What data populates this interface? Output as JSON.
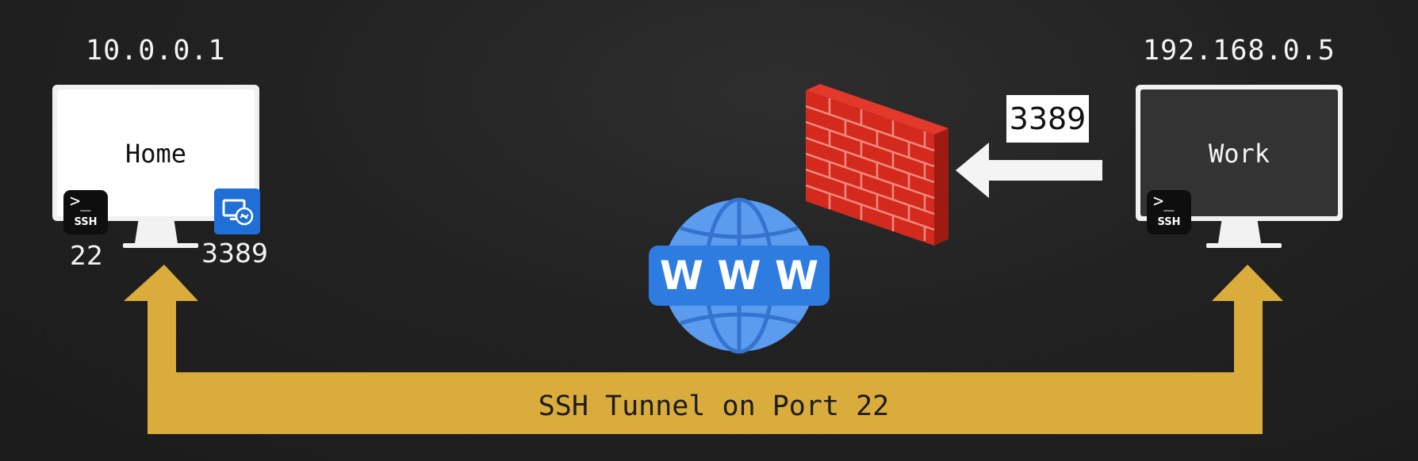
{
  "home": {
    "ip": "10.0.0.1",
    "label": "Home",
    "ssh_port": "22",
    "rdp_port": "3389",
    "ssh_badge_prompt": ">_",
    "ssh_badge_text": "SSH"
  },
  "work": {
    "ip": "192.168.0.5",
    "label": "Work",
    "ssh_badge_prompt": ">_",
    "ssh_badge_text": "SSH"
  },
  "blocked_port": "3389",
  "globe_text": "W W W",
  "tunnel": {
    "label": "SSH Tunnel on Port 22",
    "color": "#d9ac3c"
  },
  "colors": {
    "background": "#222222",
    "home_screen": "#ffffff",
    "work_screen": "#333333",
    "firewall": "#d42a1e",
    "globe": "#4a8be3",
    "rdp_badge": "#1f6fd6"
  },
  "icons": [
    "ssh-terminal-icon",
    "remote-desktop-icon",
    "firewall-brick-wall-icon",
    "globe-www-icon",
    "arrow-left-icon",
    "arrow-up-icon"
  ]
}
